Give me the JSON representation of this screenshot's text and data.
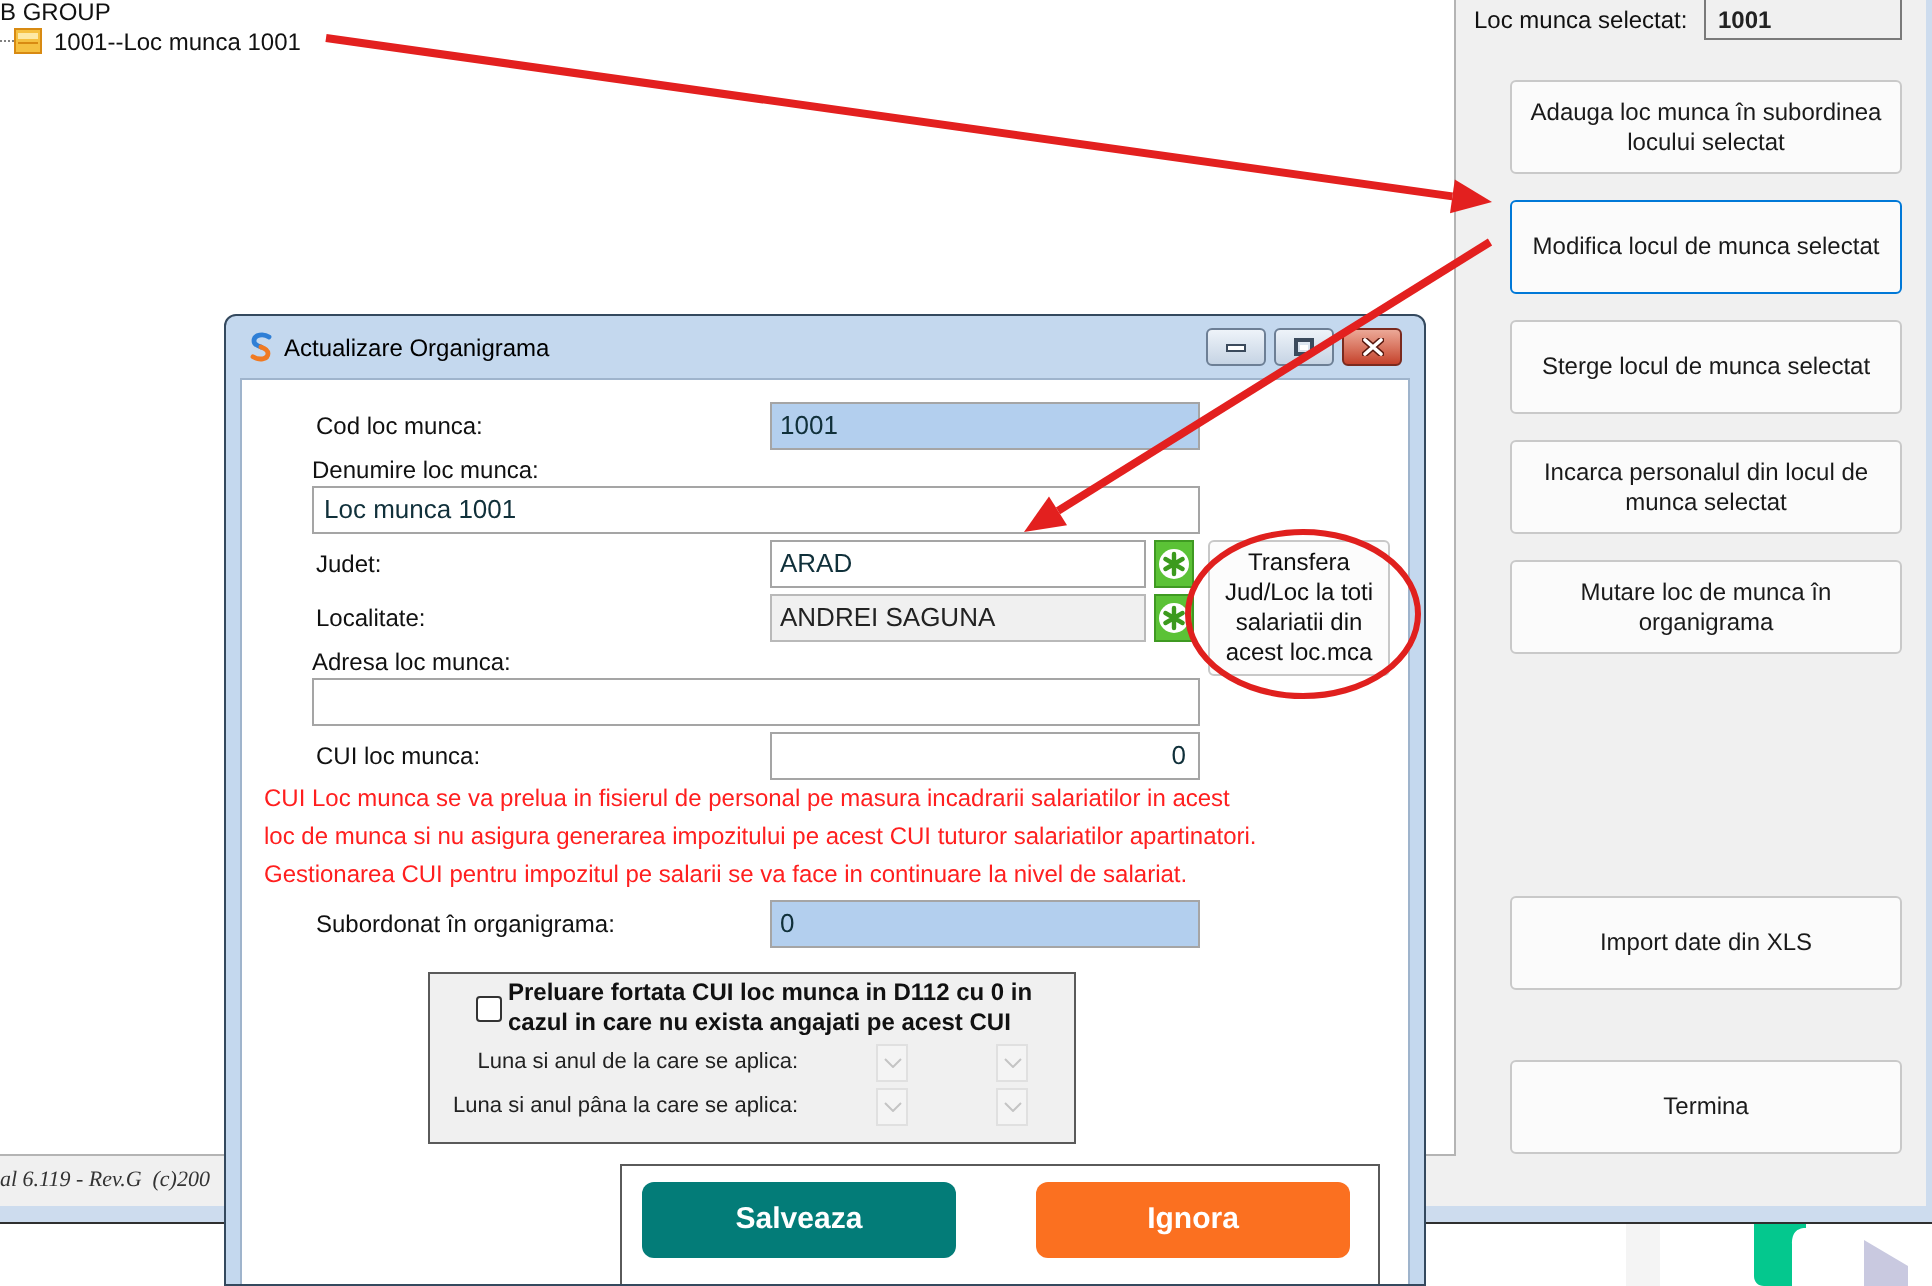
{
  "tree": [
    {
      "label": "B GROUP",
      "children": [
        {
          "label": "1001--Loc munca 1001"
        }
      ]
    }
  ],
  "status_bar": {
    "text": "al 6.119 - Rev.G  (c)200"
  },
  "side_panel": {
    "selected_label": "Loc munca selectat:",
    "selected_value": "1001",
    "buttons": [
      {
        "label": "Adauga loc munca în subordinea locului selectat",
        "focused": false
      },
      {
        "label": "Modifica locul de munca selectat",
        "focused": true
      },
      {
        "label": "Sterge locul de munca selectat",
        "focused": false
      },
      {
        "label": "Incarca personalul din locul de munca selectat",
        "focused": false
      },
      {
        "label": "Mutare loc de munca în organigrama",
        "focused": false
      }
    ],
    "lower_buttons": [
      {
        "label": "Import date din XLS",
        "focused": false
      },
      {
        "label": "Termina",
        "focused": false
      }
    ]
  },
  "dialog": {
    "title": "Actualizare Organigrama",
    "fields": [
      {
        "kind": "inline",
        "label": "Cod loc munca:",
        "value": "1001",
        "readonly": true,
        "disabled": false
      },
      {
        "kind": "stacked",
        "label": "Denumire loc munca:",
        "value": "Loc munca 1001",
        "readonly": false,
        "disabled": false
      },
      {
        "kind": "picker",
        "label": "Judet:",
        "value": "ARAD",
        "readonly": false,
        "disabled": false
      },
      {
        "kind": "picker",
        "label": "Localitate:",
        "value": "ANDREI SAGUNA",
        "readonly": false,
        "disabled": true
      },
      {
        "kind": "stacked",
        "label": "Adresa loc munca:",
        "readonly": false,
        "disabled": false
      },
      {
        "kind": "number",
        "label": "CUI loc munca:",
        "value": "0",
        "readonly": false,
        "disabled": false
      },
      {
        "kind": "note",
        "lines": [
          "CUI Loc munca se va prelua in fisierul de personal pe masura incadrarii salariatilor in acest",
          "loc de munca si nu asigura generarea impozitului pe acest CUI tuturor salariatilor apartinatori.",
          "Gestionarea CUI pentru impozitul pe salarii se va face in continuare la nivel de salariat."
        ]
      },
      {
        "kind": "inline",
        "label": "Subordonat în organigrama:",
        "value": "0",
        "readonly": true,
        "disabled": false
      }
    ],
    "transfer_button": "Transfera Jud/Loc la toti salariatii din acest loc.mca",
    "group_box": {
      "checkbox": {
        "label": "Preluare fortata CUI loc munca in D112 cu 0 in cazul in care nu exista angajati pe acest CUI",
        "checked": false
      },
      "rows": [
        {
          "label": "Luna si anul de la care se aplica:",
          "disabled": true
        },
        {
          "label": "Luna si anul pâna la care se aplica:",
          "disabled": true
        }
      ]
    },
    "buttons": [
      {
        "label": "Salveaza",
        "color": "#037c78"
      },
      {
        "label": "Ignora",
        "color": "#fb7020"
      }
    ]
  },
  "annotations": [
    {
      "kind": "arrow"
    },
    {
      "kind": "arrow"
    },
    {
      "kind": "ellipse"
    }
  ]
}
